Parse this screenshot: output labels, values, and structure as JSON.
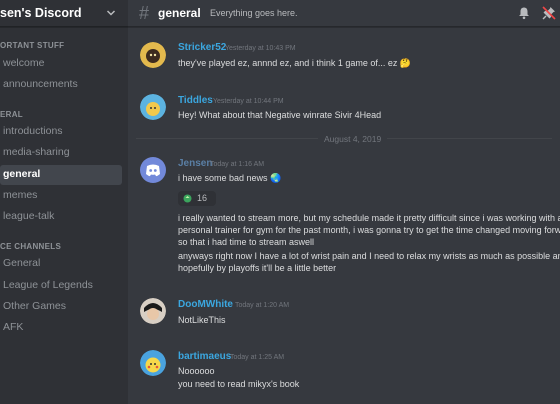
{
  "sidebar": {
    "server_name": "sen's Discord",
    "categories": [
      {
        "label": "ORTANT STUFF"
      },
      {
        "label": "ERAL"
      },
      {
        "label": "CE CHANNELS"
      }
    ],
    "channels": [
      {
        "label": "welcome"
      },
      {
        "label": "announcements"
      },
      {
        "label": "introductions"
      },
      {
        "label": "media-sharing"
      },
      {
        "label": "general"
      },
      {
        "label": "memes"
      },
      {
        "label": "league-talk"
      },
      {
        "label": "General"
      },
      {
        "label": "League of Legends"
      },
      {
        "label": "Other Games"
      },
      {
        "label": "AFK"
      }
    ],
    "active_channel": "general"
  },
  "header": {
    "hash": "#",
    "channel": "general",
    "topic": "Everything goes here."
  },
  "divider": {
    "date": "August 4, 2019"
  },
  "messages": [
    {
      "author": "Stricker52",
      "author_color": "#3ba7e0",
      "timestamp": "Yesterday at 10:43 PM",
      "lines": [
        "they've played ez, annnd ez, and i think 1 game of... ez 🤔"
      ]
    },
    {
      "author": "Tiddles",
      "author_color": "#3ba7e0",
      "timestamp": "Yesterday at 10:44 PM",
      "lines": [
        "Hey! What about that Negative winrate Sivir 4Head"
      ]
    },
    {
      "author": "Jensen",
      "author_color": "#5a7fa5",
      "timestamp": "Today at 1:16 AM",
      "lines": [
        "i have some bad news 🌏",
        "i really wanted to stream more, but my schedule made it pretty difficult since i was working with a",
        "personal trainer for gym for the past month, i was gonna try to get the time changed moving forwa",
        "so that i had time to stream aswell",
        "anyways right now I have a lot of wrist pain and I need to relax my wrists as much as possible and",
        "hopefully by playoffs it'll be a little better"
      ],
      "reaction_count": "16"
    },
    {
      "author": "DooMWhite",
      "author_color": "#3ba7e0",
      "timestamp": "Today at 1:20 AM",
      "lines": [
        "NotLikeThis"
      ]
    },
    {
      "author": "bartimaeus",
      "author_color": "#3ba7e0",
      "timestamp": "Today at 1:25 AM",
      "lines": [
        "Noooooo",
        "you need to read mikyx's book"
      ]
    }
  ],
  "colors": {
    "sidebar_bg": "#2f3136",
    "main_bg": "#36393f",
    "active_channel_bg": "#42464d",
    "text": "#dcddde",
    "muted": "#8e9297"
  },
  "icons": [
    "chevron-down-icon",
    "hash-icon",
    "bell-icon",
    "pin-icon",
    "discord-logo-icon"
  ]
}
